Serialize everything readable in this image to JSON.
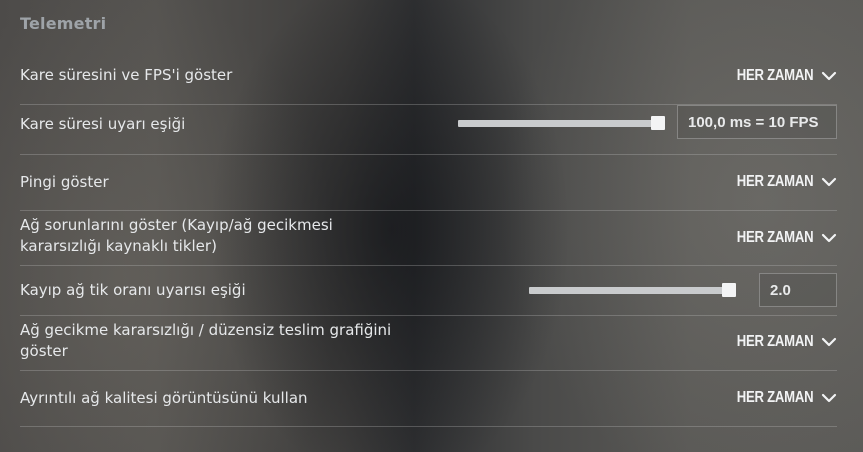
{
  "section": {
    "title": "Telemetri"
  },
  "rows": [
    {
      "label": "Kare süresini ve FPS'i göster",
      "value": "HER ZAMAN"
    },
    {
      "label": "Kare süresi uyarı eşiği",
      "value": "100,0 ms = 10 FPS",
      "slider_fraction": 1.0
    },
    {
      "label": "Pingi göster",
      "value": "HER ZAMAN"
    },
    {
      "label": "Ağ sorunlarını göster (Kayıp/ağ gecikmesi kararsızlığı kaynaklı tikler)",
      "value": "HER ZAMAN"
    },
    {
      "label": "Kayıp ağ tik oranı uyarısı eşiği",
      "value": "2.0",
      "slider_fraction": 1.0
    },
    {
      "label": "Ağ gecikme kararsızlığı / düzensiz teslim grafiğini göster",
      "value": "HER ZAMAN"
    },
    {
      "label": "Ayrıntılı ağ kalitesi görüntüsünü kullan",
      "value": "HER ZAMAN"
    }
  ],
  "icons": {
    "dropdown": "chevron-down-icon"
  },
  "colors": {
    "text": "#e6e8ea",
    "section_title": "#9ea3a8",
    "slider_track": "#c9cbcd"
  }
}
